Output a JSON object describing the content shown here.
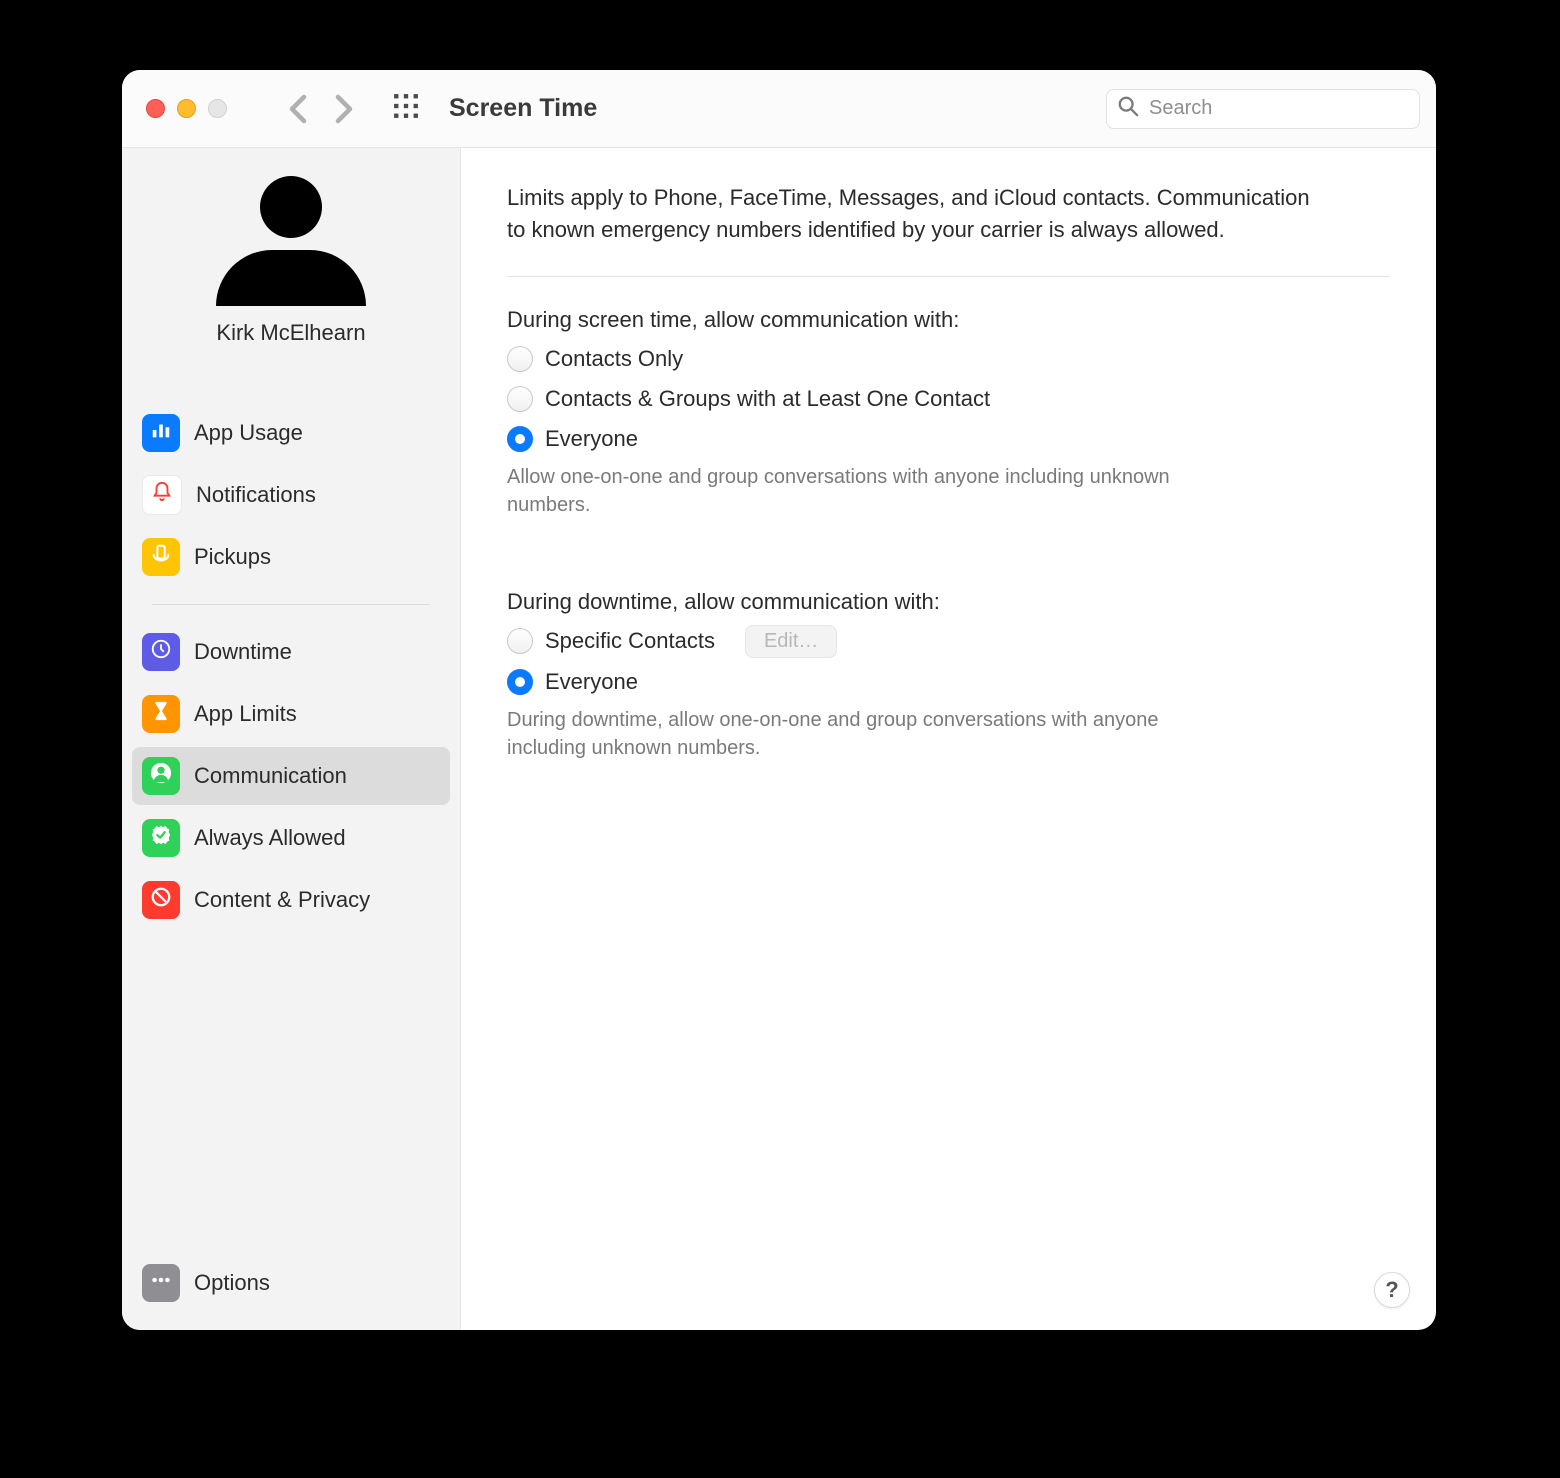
{
  "titlebar": {
    "title": "Screen Time",
    "search_placeholder": "Search"
  },
  "profile": {
    "name": "Kirk McElhearn"
  },
  "sidebar": {
    "groups": [
      [
        {
          "id": "app-usage",
          "label": "App Usage",
          "color": "#0a7aff",
          "icon": "bar"
        },
        {
          "id": "notifications",
          "label": "Notifications",
          "color": "#ffffff",
          "icon": "bell",
          "iconColor": "#ff3b30",
          "border": true
        },
        {
          "id": "pickups",
          "label": "Pickups",
          "color": "#ffc502",
          "icon": "pickups"
        }
      ],
      [
        {
          "id": "downtime",
          "label": "Downtime",
          "color": "#5e5ce6",
          "icon": "clock"
        },
        {
          "id": "app-limits",
          "label": "App Limits",
          "color": "#ff9500",
          "icon": "hourglass"
        },
        {
          "id": "communication",
          "label": "Communication",
          "color": "#30d158",
          "icon": "person",
          "selected": true
        },
        {
          "id": "always-allowed",
          "label": "Always Allowed",
          "color": "#30d158",
          "icon": "check"
        },
        {
          "id": "content-privacy",
          "label": "Content & Privacy",
          "color": "#ff3b30",
          "icon": "ban"
        }
      ]
    ],
    "options": {
      "label": "Options",
      "color": "#8e8e93",
      "icon": "dots"
    }
  },
  "content": {
    "intro": "Limits apply to Phone, FaceTime, Messages, and iCloud contacts. Communication to known emergency numbers identified by your carrier is always allowed.",
    "section1": {
      "title": "During screen time, allow communication with:",
      "options": [
        {
          "label": "Contacts Only",
          "checked": false
        },
        {
          "label": "Contacts & Groups with at Least One Contact",
          "checked": false
        },
        {
          "label": "Everyone",
          "checked": true
        }
      ],
      "help": "Allow one-on-one and group conversations with anyone including unknown numbers."
    },
    "section2": {
      "title": "During downtime, allow communication with:",
      "edit_label": "Edit…",
      "options": [
        {
          "label": "Specific Contacts",
          "checked": false,
          "hasEdit": true
        },
        {
          "label": "Everyone",
          "checked": true
        }
      ],
      "help": "During downtime, allow one-on-one and group conversations with anyone including unknown numbers."
    },
    "help_button": "?"
  }
}
